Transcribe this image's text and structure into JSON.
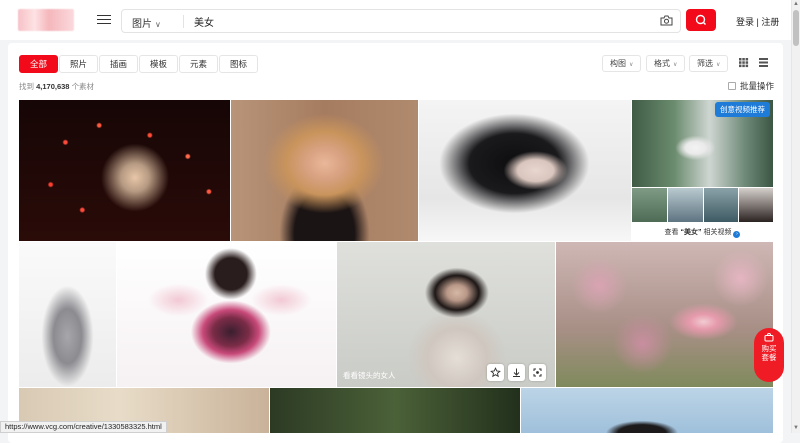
{
  "header": {
    "search_type": "图片",
    "search_query": "美女",
    "login_label": "登录",
    "login_sep": "|",
    "register_label": "注册"
  },
  "filters": {
    "tabs": [
      "全部",
      "照片",
      "插画",
      "模板",
      "元素",
      "图标"
    ],
    "active_index": 0,
    "dropdowns": [
      "构图",
      "格式",
      "筛选"
    ]
  },
  "results": {
    "prefix": "找到",
    "count": "4,170,638",
    "suffix": "个素材",
    "batch_label": "批量操作"
  },
  "ad": {
    "badge": "创意视频推荐",
    "caption_pre": "查看 ",
    "caption_kw": "“美女”",
    "caption_post": " 相关视频",
    "caption_icon": "›"
  },
  "hover": {
    "caption": "看看镜头的女人"
  },
  "buy_button": {
    "line1": "购买",
    "line2": "套餐"
  },
  "status_url": "https://www.vcg.com/creative/1330583325.html",
  "colors": {
    "brand_red": "#f20a1a",
    "ad_blue": "#1f7bd8"
  },
  "icons": [
    "menu-icon",
    "camera-icon",
    "search-icon",
    "grid-view-icon",
    "list-view-icon",
    "star-icon",
    "download-icon",
    "expand-icon",
    "cart-icon"
  ]
}
